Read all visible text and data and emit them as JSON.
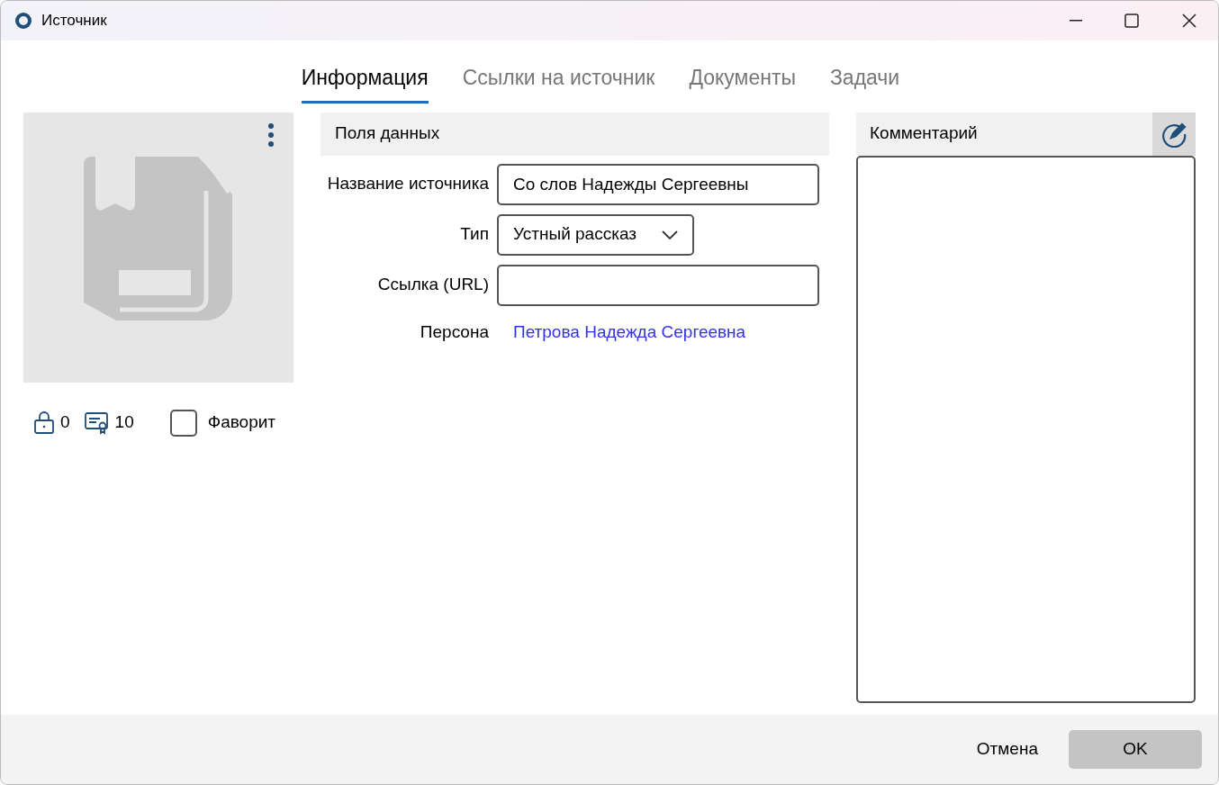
{
  "window": {
    "title": "Источник"
  },
  "tabs": [
    {
      "label": "Информация",
      "selected": true
    },
    {
      "label": "Ссылки на источник",
      "selected": false
    },
    {
      "label": "Документы",
      "selected": false
    },
    {
      "label": "Задачи",
      "selected": false
    }
  ],
  "cover": {
    "stats": [
      {
        "kind": "lock",
        "value": "0"
      },
      {
        "kind": "certificate",
        "value": "10"
      }
    ],
    "favorite": {
      "label": "Фаворит",
      "checked": false
    }
  },
  "data_fields": {
    "title": "Поля данных",
    "fields": [
      {
        "kind": "text",
        "label": "Название источника",
        "value": "Со слов Надежды Сергеевны"
      },
      {
        "kind": "select",
        "label": "Тип",
        "value": "Устный рассказ"
      },
      {
        "kind": "text",
        "label": "Ссылка (URL)"
      },
      {
        "kind": "link",
        "label": "Персона",
        "value": "Петрова Надежда Сергеевна"
      }
    ]
  },
  "comment": {
    "title": "Комментарий"
  },
  "buttons": [
    {
      "kind": "plain",
      "label": "Отмена"
    },
    {
      "kind": "primary",
      "label": "OK"
    }
  ]
}
